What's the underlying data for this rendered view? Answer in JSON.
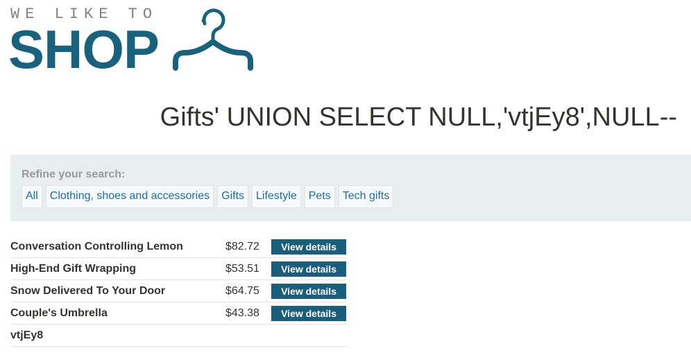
{
  "logo": {
    "tagline": "WE LIKE TO",
    "word": "SHOP",
    "icon": "hanger-icon",
    "color": "#19627d"
  },
  "heading": "Gifts' UNION SELECT NULL,'vtjEy8',NULL--",
  "filter": {
    "label": "Refine your search:",
    "links": [
      "All",
      "Clothing, shoes and accessories",
      "Gifts",
      "Lifestyle",
      "Pets",
      "Tech gifts"
    ]
  },
  "products": [
    {
      "name": "Conversation Controlling Lemon",
      "price": "$82.72",
      "button": "View details"
    },
    {
      "name": "High-End Gift Wrapping",
      "price": "$53.51",
      "button": "View details"
    },
    {
      "name": "Snow Delivered To Your Door",
      "price": "$64.75",
      "button": "View details"
    },
    {
      "name": "Couple's Umbrella",
      "price": "$43.38",
      "button": "View details"
    },
    {
      "name": "vtjEy8",
      "price": "",
      "button": ""
    }
  ],
  "colors": {
    "accent": "#1a5e7d",
    "link": "#1a6ea6",
    "panel_bg": "#e8edf0"
  }
}
